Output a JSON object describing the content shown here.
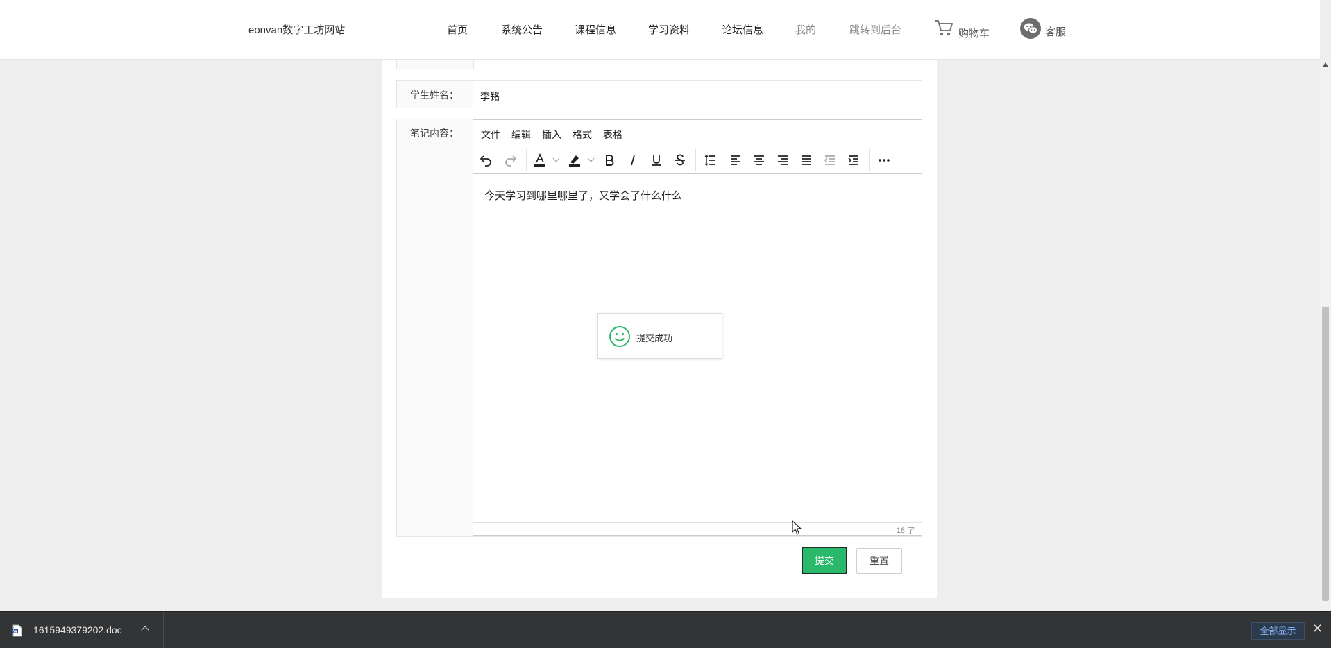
{
  "header": {
    "logo": "eonvan数字工坊网站",
    "nav": [
      "首页",
      "系统公告",
      "课程信息",
      "学习资料",
      "论坛信息",
      "我的",
      "跳转到后台"
    ],
    "cart_label": "购物车",
    "service_label": "客服"
  },
  "form": {
    "student_name_label": "学生姓名：",
    "student_name_value": "李铭",
    "note_label": "笔记内容：",
    "editor": {
      "menus": [
        "文件",
        "编辑",
        "插入",
        "格式",
        "表格"
      ],
      "content": "今天学习到哪里哪里了，又学会了什么什么",
      "word_count": "18 字"
    },
    "submit_label": "提交",
    "reset_label": "重置"
  },
  "toast": {
    "message": "提交成功",
    "icon": "smiley-icon",
    "color": "#2ab86a"
  },
  "download_bar": {
    "filename": "1615949379202.doc",
    "show_all_label": "全部显示"
  },
  "colors": {
    "accent": "#2ab86a",
    "page_bg": "#eeeeee",
    "download_bar_bg": "#333436"
  }
}
